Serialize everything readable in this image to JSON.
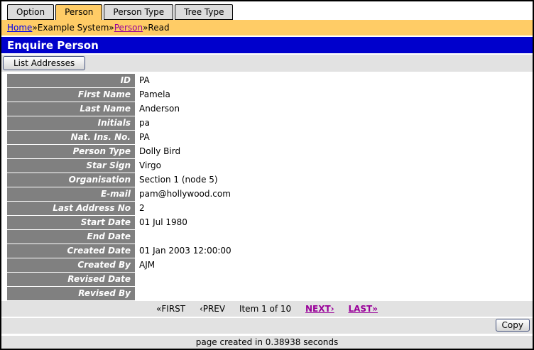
{
  "tabs": [
    {
      "label": "Option",
      "active": false
    },
    {
      "label": "Person",
      "active": true
    },
    {
      "label": "Person Type",
      "active": false
    },
    {
      "label": "Tree Type",
      "active": false
    }
  ],
  "breadcrumb": {
    "separator": "»",
    "items": [
      {
        "label": "Home",
        "style": "link"
      },
      {
        "label": "Example System",
        "style": "text"
      },
      {
        "label": "Person",
        "style": "visited-link"
      },
      {
        "label": "Read",
        "style": "text"
      }
    ]
  },
  "header": {
    "title": "Enquire Person"
  },
  "toolbar": {
    "list_addresses_label": "List Addresses"
  },
  "record": {
    "fields": [
      {
        "label": "ID",
        "value": "PA"
      },
      {
        "label": "First Name",
        "value": "Pamela"
      },
      {
        "label": "Last Name",
        "value": "Anderson"
      },
      {
        "label": "Initials",
        "value": "pa"
      },
      {
        "label": "Nat. Ins. No.",
        "value": "PA"
      },
      {
        "label": "Person Type",
        "value": "Dolly Bird"
      },
      {
        "label": "Star Sign",
        "value": "Virgo"
      },
      {
        "label": "Organisation",
        "value": "Section 1 (node 5)"
      },
      {
        "label": "E-mail",
        "value": "pam@hollywood.com"
      },
      {
        "label": "Last Address No",
        "value": "2"
      },
      {
        "label": "Start Date",
        "value": "01 Jul 1980"
      },
      {
        "label": "End Date",
        "value": ""
      },
      {
        "label": "Created Date",
        "value": "01 Jan 2003 12:00:00"
      },
      {
        "label": "Created By",
        "value": "AJM"
      },
      {
        "label": "Revised Date",
        "value": ""
      },
      {
        "label": "Revised By",
        "value": ""
      }
    ]
  },
  "pagination": {
    "first_label": "«FIRST",
    "prev_label": "‹PREV",
    "status": "Item 1 of 10",
    "next_label": "NEXT›",
    "last_label": "LAST»"
  },
  "actions": {
    "copy_label": "Copy"
  },
  "footer": {
    "text": "page created in 0.38938 seconds"
  },
  "colors": {
    "accent_orange": "#FFCC66",
    "header_blue": "#0000CC",
    "label_gray": "#808080",
    "bar_gray": "#E2E2E2",
    "tab_gray": "#DCDCDC",
    "link_blue": "#0000EE",
    "link_visited_purple": "#990099"
  }
}
